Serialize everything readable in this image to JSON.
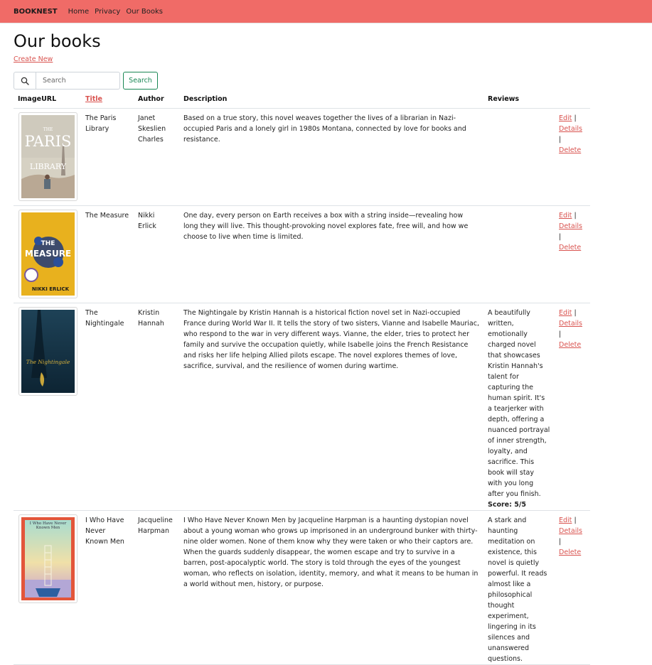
{
  "navbar": {
    "brand": "BOOKNEST",
    "links": [
      "Home",
      "Privacy",
      "Our Books"
    ]
  },
  "page": {
    "title": "Our books",
    "create_new": "Create New"
  },
  "search": {
    "placeholder": "Search",
    "button_label": "Search"
  },
  "table": {
    "headers": [
      "ImageURL",
      "Title",
      "Author",
      "Description",
      "Reviews"
    ],
    "actions": {
      "edit": "Edit",
      "details": "Details",
      "delete": "Delete",
      "separator": "|"
    },
    "rows": [
      {
        "title": "The Paris Library",
        "author": "Janet Skeslien Charles",
        "description": "Based on a true story, this novel weaves together the lives of a librarian in Nazi-occupied Paris and a lonely girl in 1980s Montana, connected by love for books and resistance.",
        "review": "",
        "score": ""
      },
      {
        "title": "The Measure",
        "author": "Nikki Erlick",
        "description": "One day, every person on Earth receives a box with a string inside—revealing how long they will live. This thought-provoking novel explores fate, free will, and how we choose to live when time is limited.",
        "review": "",
        "score": ""
      },
      {
        "title": "The Nightingale",
        "author": "Kristin Hannah",
        "description": "The Nightingale by Kristin Hannah is a historical fiction novel set in Nazi-occupied France during World War II. It tells the story of two sisters, Vianne and Isabelle Mauriac, who respond to the war in very different ways. Vianne, the elder, tries to protect her family and survive the occupation quietly, while Isabelle joins the French Resistance and risks her life helping Allied pilots escape. The novel explores themes of love, sacrifice, survival, and the resilience of women during wartime.",
        "review": "A beautifully written, emotionally charged novel that showcases Kristin Hannah's talent for capturing the human spirit. It's a tearjerker with depth, offering a nuanced portrayal of inner strength, loyalty, and sacrifice. This book will stay with you long after you finish.",
        "score": "Score: 5/5"
      },
      {
        "title": "I Who Have Never Known Men",
        "author": "Jacqueline Harpman",
        "description": "I Who Have Never Known Men by Jacqueline Harpman is a haunting dystopian novel about a young woman who grows up imprisoned in an underground bunker with thirty-nine older women. None of them know why they were taken or who their captors are. When the guards suddenly disappear, the women escape and try to survive in a barren, post-apocalyptic world. The story is told through the eyes of the youngest woman, who reflects on isolation, identity, memory, and what it means to be human in a world without men, history, or purpose.",
        "review": "A stark and haunting meditation on existence, this novel is quietly powerful. It reads almost like a philosophical thought experiment, lingering in its silences and unanswered questions.",
        "score": ""
      }
    ]
  },
  "covers": [
    {
      "top_text": "THE",
      "main_text": "PARIS",
      "sub_text": "LIBRARY",
      "colors": {
        "bg": "#d7d2c4",
        "sky": "#c9c6bd",
        "text": "#ffffff"
      }
    },
    {
      "top_text": "THE",
      "main_text": "MEASURE",
      "sub_text": "NIKKI ERLICK",
      "colors": {
        "bg": "#e9b21f",
        "accent": "#1e3a7a",
        "text": "#ffffff"
      }
    },
    {
      "main_text": "The Nightingale",
      "colors": {
        "bg": "#163447",
        "text": "#d8b13a"
      }
    },
    {
      "main_text": "I Who Have Never Known Men",
      "colors": {
        "bg": "#e3563a",
        "inner": "#9fd3c7",
        "text": "#334"
      }
    }
  ],
  "colors": {
    "navbar": "#f06b67",
    "link": "#d9534f",
    "search_button": "#198754"
  }
}
